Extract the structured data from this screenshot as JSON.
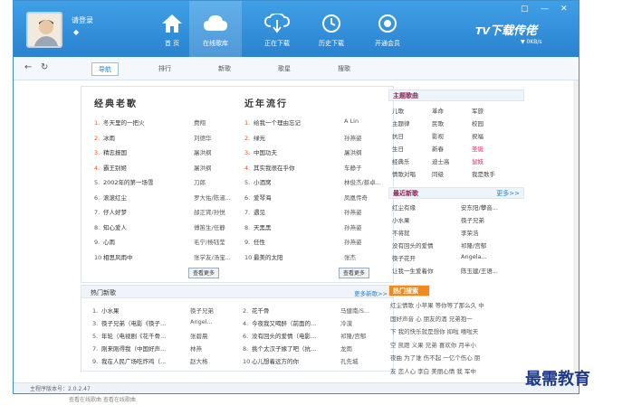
{
  "header": {
    "login": "请登录",
    "nav": [
      "首 页",
      "在线歌库",
      "正在下载",
      "历史下载",
      "开通会员"
    ],
    "brand": "下载传佬",
    "speed": "0KB/s"
  },
  "tabs": [
    "导航",
    "排行",
    "新歌",
    "歌星",
    "搜歌"
  ],
  "classic": {
    "title": "经典老歌",
    "songs": [
      {
        "n": "1.",
        "s": "冬天里的一把火",
        "a": "费翔"
      },
      {
        "n": "2.",
        "s": "冰雨",
        "a": "刘德华"
      },
      {
        "n": "3.",
        "s": "精忠报国",
        "a": "屠洪纲"
      },
      {
        "n": "4.",
        "s": "霸王别姬",
        "a": "屠洪纲"
      },
      {
        "n": "5.",
        "s": "2002年的第一场雪",
        "a": "刀郎"
      },
      {
        "n": "6.",
        "s": "滚滚红尘",
        "a": "罗大佑/陈淑..."
      },
      {
        "n": "7.",
        "s": "仔人好梦",
        "a": "邰正宵/孙悦"
      },
      {
        "n": "8.",
        "s": "知心爱人",
        "a": "傅笛生/任静"
      },
      {
        "n": "9.",
        "s": "心雨",
        "a": "毛宁/杨钰莹"
      },
      {
        "n": "10",
        "s": "相思风雨中",
        "a": "张学友/汤宝..."
      }
    ],
    "more": "查看更多"
  },
  "popular": {
    "title": "近年流行",
    "songs": [
      {
        "n": "1.",
        "s": "给我一个理由忘记",
        "a": "A Lin"
      },
      {
        "n": "2.",
        "s": "绿光",
        "a": "孙燕姿"
      },
      {
        "n": "3.",
        "s": "中国功夫",
        "a": "屠洪纲"
      },
      {
        "n": "4.",
        "s": "其实我很在乎你",
        "a": "车静子"
      },
      {
        "n": "5.",
        "s": "小酒窝",
        "a": "林俊杰/蔡卓..."
      },
      {
        "n": "6.",
        "s": "爱琴海",
        "a": "凤凰传奇"
      },
      {
        "n": "7.",
        "s": "遇见",
        "a": "孙燕姿"
      },
      {
        "n": "8.",
        "s": "天黑黑",
        "a": "孙燕姿"
      },
      {
        "n": "9.",
        "s": "任性",
        "a": "孙燕姿"
      },
      {
        "n": "10",
        "s": "最美的太阳",
        "a": "张杰"
      }
    ],
    "more": "查看更多"
  },
  "hot": {
    "title": "热门新歌",
    "more": "更多新歌>>",
    "left": [
      {
        "n": "1.",
        "s": "小水果",
        "a": "筷子兄弟"
      },
      {
        "n": "3.",
        "s": "筷子兄弟（电影《筷子...",
        "a": "Angel..."
      },
      {
        "n": "5.",
        "s": "年轮（电视剧《花千骨...",
        "a": "张碧晨"
      },
      {
        "n": "7.",
        "s": "刚来刚得我（中国好声...",
        "a": "林燕"
      },
      {
        "n": "9.",
        "s": "我在人民广场吃炸鸡（...",
        "a": "赵大格"
      }
    ],
    "right": [
      {
        "n": "2.",
        "s": "花千骨",
        "a": "马健南/S..."
      },
      {
        "n": "4.",
        "s": "今夜我又喝醉（前面的...",
        "a": "冷漠"
      },
      {
        "n": "6.",
        "s": "没有回头的爱情（电影...",
        "a": "祁隆/宫郁"
      },
      {
        "n": "8.",
        "s": "挑个太汉子嫁了吧（抗...",
        "a": "龙雨"
      },
      {
        "n": "10",
        "s": "心儿想着远方的你",
        "a": "孔先城"
      }
    ]
  },
  "themes": {
    "title": "主题歌曲",
    "rows": [
      [
        "儿歌",
        "革命",
        "军旅"
      ],
      [
        "主题律",
        "民歌",
        "校园"
      ],
      [
        "抗日",
        "影视",
        "祝福"
      ],
      [
        "生日",
        "新春",
        "圣诞"
      ],
      [
        "经典乐",
        "迪士高",
        "鼠妓"
      ],
      [
        "情歌对唱",
        "同级",
        "我是歌手"
      ]
    ]
  },
  "newest": {
    "title": "最近新歌",
    "more": "更多>>",
    "rows": [
      [
        "红尘有缘",
        "安东阳/攀音..."
      ],
      [
        "小水果",
        "筷子兄弟"
      ],
      [
        "不将就",
        "李荣浩"
      ],
      [
        "没有回头的爱情",
        "祁隆/宫郁"
      ],
      [
        "筷子花开",
        "Angela..."
      ],
      [
        "让我一生爱着你",
        "陈玉建/王语..."
      ]
    ]
  },
  "hotsearch": {
    "title": "热门搜索",
    "lines": [
      "红尘情歌 小苹果 等你等了那么久 中",
      "国好声音 心 朋友的酒 兄弟抱一",
      "下 我的快乐就是想你 抑啦 嘻啦天",
      "空 凯蹬 义果 兄弟 喜欢你 月半小",
      "夜曲 为了谁 伤不起 一亿个伤心 朋",
      "友 恋人心 李白 美丽心情 我 军中"
    ]
  },
  "status": "主程序版本号：2.0.2.47",
  "watermark": "最需教育",
  "footer": "查看在线歌曲      查看在线歌曲"
}
